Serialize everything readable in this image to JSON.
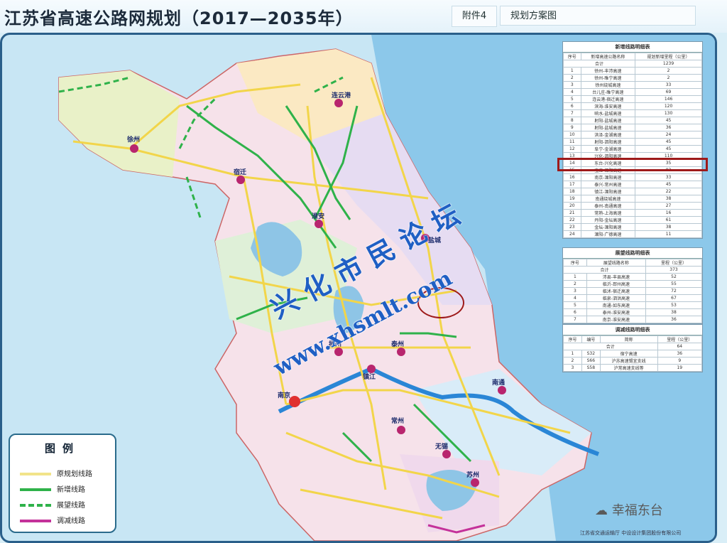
{
  "header": {
    "title": "江苏省高速公路网规划（2017—2035年）",
    "attachment": "附件4",
    "map_name": "规划方案图"
  },
  "cities": [
    "徐州",
    "连云港",
    "宿迁",
    "淮安",
    "盐城",
    "扬州",
    "泰州",
    "南京",
    "镇江",
    "常州",
    "南通",
    "无锡",
    "苏州"
  ],
  "table_new": {
    "caption": "新增线路明细表",
    "headers": [
      "序号",
      "新增高速公路名称",
      "规划新增里程（公里）"
    ],
    "total_label": "合计",
    "total_value": "1239",
    "rows": [
      [
        "1",
        "徐州-丰沛高速",
        "2"
      ],
      [
        "2",
        "徐州-睢宁高速",
        "2"
      ],
      [
        "3",
        "徐州绕城高速",
        "33"
      ],
      [
        "4",
        "台儿庄-睢宁高速",
        "69"
      ],
      [
        "5",
        "连云港-宿迁高速",
        "146"
      ],
      [
        "6",
        "滨海-淮安高速",
        "120"
      ],
      [
        "7",
        "响水-盐城高速",
        "130"
      ],
      [
        "8",
        "射阳-盐城高速",
        "45"
      ],
      [
        "9",
        "射阳-盐城高速",
        "36"
      ],
      [
        "10",
        "洪泽-金湖高速",
        "24"
      ],
      [
        "11",
        "射阳-泗阳高速",
        "45"
      ],
      [
        "12",
        "阜宁-金湖高速",
        "45"
      ],
      [
        "13",
        "兴化-泗阳高速",
        "110"
      ],
      [
        "14",
        "东台-兴化高速",
        "35"
      ],
      [
        "15",
        "宝应-溧阳高速",
        "83"
      ],
      [
        "16",
        "南京-溧阳高速",
        "33"
      ],
      [
        "17",
        "泰兴-常州高速",
        "45"
      ],
      [
        "18",
        "镇江-溧阳高速",
        "22"
      ],
      [
        "19",
        "南通绕城高速",
        "38"
      ],
      [
        "20",
        "泰州-南通高速",
        "27"
      ],
      [
        "21",
        "常熟-上海高速",
        "16"
      ],
      [
        "22",
        "丹阳-金坛高速",
        "61"
      ],
      [
        "23",
        "金坛-溧阳高速",
        "38"
      ],
      [
        "24",
        "溧阳-广德高速",
        "11"
      ]
    ]
  },
  "table_plan": {
    "caption": "展望线路明细表",
    "headers": [
      "序号",
      "展望线路名称",
      "里程（公里）"
    ],
    "total_label": "合计",
    "total_value": "373",
    "rows": [
      [
        "1",
        "沛县-丰县高速",
        "52"
      ],
      [
        "2",
        "临沂-邳州高速",
        "55"
      ],
      [
        "3",
        "临沭-宿迁高速",
        "72"
      ],
      [
        "4",
        "临泉-泗洪高速",
        "67"
      ],
      [
        "5",
        "南通-如东高速",
        "53"
      ],
      [
        "6",
        "泰州-淮安高速",
        "38"
      ],
      [
        "7",
        "南京-淮安高速",
        "36"
      ]
    ]
  },
  "table_cut": {
    "caption": "调减线路明细表",
    "headers": [
      "序号",
      "编号",
      "简称",
      "里程（公里）"
    ],
    "total_label": "合计",
    "total_value": "64",
    "rows": [
      [
        "1",
        "S32",
        "宿宁高速",
        "36"
      ],
      [
        "2",
        "S66",
        "沪苏高速锡宜支线",
        "9"
      ],
      [
        "3",
        "S58",
        "沪常高速支线等",
        "19"
      ]
    ]
  },
  "legend": {
    "title": "图例",
    "items": [
      {
        "label": "原规划线路",
        "color": "#f2e38a",
        "style": "solid"
      },
      {
        "label": "新增线路",
        "color": "#2fb24a",
        "style": "solid"
      },
      {
        "label": "展望线路",
        "color": "#2fb24a",
        "style": "dashed"
      },
      {
        "label": "调减线路",
        "color": "#c4329a",
        "style": "solid"
      }
    ]
  },
  "watermark": {
    "line1": "兴 化 市 民 论 坛",
    "line2": "www.xhsmlt.com"
  },
  "brand": "幸福东台",
  "footer": "江苏省交通运输厅    中设设计集团股份有限公司"
}
